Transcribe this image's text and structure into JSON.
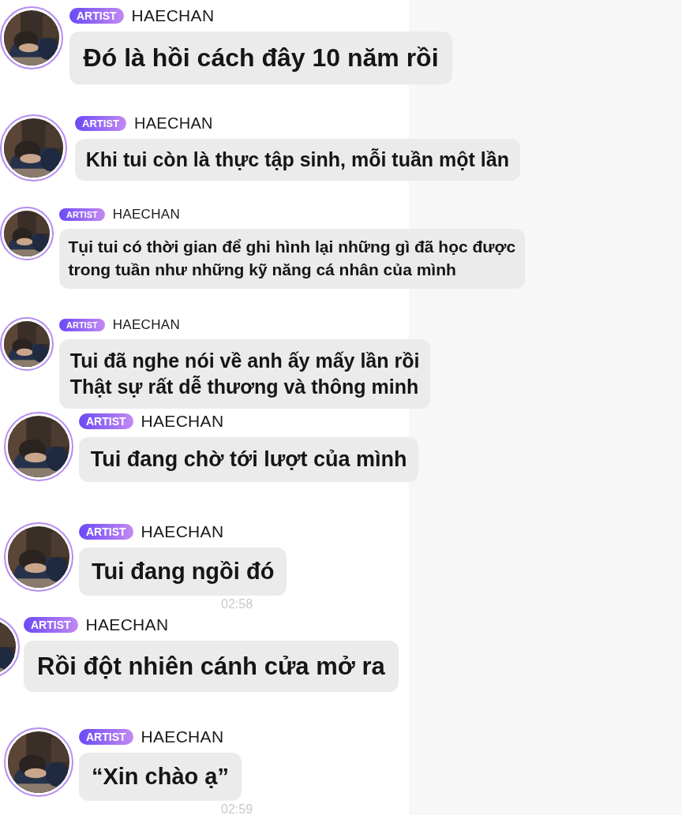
{
  "messages": [
    {
      "badge": "ARTIST",
      "sender": "HAECHAN",
      "text": "Đó là hồi cách đây 10 năm rồi"
    },
    {
      "badge": "ARTIST",
      "sender": "HAECHAN",
      "text": "Khi tui còn là thực tập sinh, mỗi tuần một lần"
    },
    {
      "badge": "ARTIST",
      "sender": "HAECHAN",
      "text": "Tụi tui có thời gian để ghi hình lại những gì đã học được\ntrong tuần như những kỹ năng cá nhân của mình"
    },
    {
      "badge": "ARTIST",
      "sender": "HAECHAN",
      "text": "Tui đã nghe nói về anh ấy mấy lần rồi\nThật sự rất dễ thương và thông minh"
    },
    {
      "badge": "ARTIST",
      "sender": "HAECHAN",
      "text": "Tui đang chờ tới lượt của mình"
    },
    {
      "badge": "ARTIST",
      "sender": "HAECHAN",
      "text": "Tui đang ngồi đó",
      "time": "02:58"
    },
    {
      "badge": "ARTIST",
      "sender": "HAECHAN",
      "text": "Rồi đột nhiên cánh cửa mở ra"
    },
    {
      "badge": "ARTIST",
      "sender": "HAECHAN",
      "text": "“Xin chào ạ”",
      "time": "02:59"
    }
  ]
}
